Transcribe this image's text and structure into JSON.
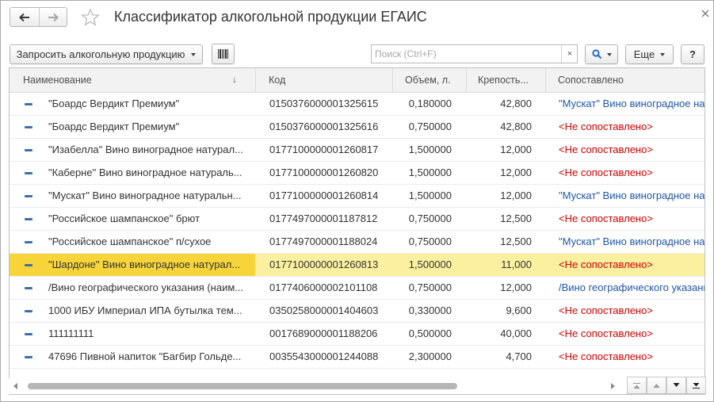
{
  "window": {
    "title": "Классификатор алкогольной продукции ЕГАИС",
    "close_glyph": "×"
  },
  "toolbar": {
    "request_button_label": "Запросить алкогольную продукцию",
    "search_placeholder": "Поиск (Ctrl+F)",
    "search_value": "",
    "search_clear_glyph": "×",
    "more_label": "Еще",
    "help_label": "?"
  },
  "table": {
    "columns": [
      "Наименование",
      "Код",
      "Объем, л.",
      "Крепость...",
      "Сопоставлено"
    ],
    "sort_indicator": "↓",
    "rows": [
      {
        "name": "\"Боардс Вердикт Премиум\"",
        "code": "0150376000001325615",
        "volume": "0,180000",
        "strength": "42,800",
        "match": "\"Мускат\" Вино виноградное на",
        "matched": true
      },
      {
        "name": "\"Боардс Вердикт Премиум\"",
        "code": "0150376000001325616",
        "volume": "0,750000",
        "strength": "42,800",
        "match": "<Не сопоставлено>",
        "matched": false
      },
      {
        "name": "\"Изабелла\" Вино виноградное натурал...",
        "code": "0177100000001260817",
        "volume": "1,500000",
        "strength": "12,000",
        "match": "<Не сопоставлено>",
        "matched": false
      },
      {
        "name": "\"Каберне\" Вино виноградное натураль...",
        "code": "0177100000001260820",
        "volume": "1,500000",
        "strength": "12,000",
        "match": "<Не сопоставлено>",
        "matched": false
      },
      {
        "name": "\"Мускат\" Вино виноградное натуральн...",
        "code": "0177100000001260814",
        "volume": "1,500000",
        "strength": "12,000",
        "match": "\"Мускат\" Вино виноградное на",
        "matched": true
      },
      {
        "name": "\"Российское шампанское\" брют",
        "code": "0177497000001187812",
        "volume": "0,750000",
        "strength": "12,500",
        "match": "<Не сопоставлено>",
        "matched": false
      },
      {
        "name": "\"Российское шампанское\" п/сухое",
        "code": "0177497000001188024",
        "volume": "0,750000",
        "strength": "12,500",
        "match": "\"Мускат\" Вино виноградное на",
        "matched": true
      },
      {
        "name": "\"Шардоне\" Вино виноградное натурал...",
        "code": "0177100000001260813",
        "volume": "1,500000",
        "strength": "11,000",
        "match": "<Не сопоставлено>",
        "matched": false,
        "selected": true
      },
      {
        "name": "/Вино географического указания (наим...",
        "code": "0177406000002101108",
        "volume": "0,750000",
        "strength": "12,000",
        "match": "/Вино географического указани",
        "matched": true
      },
      {
        "name": "1000 ИБУ Империал ИПА бутылка тем...",
        "code": "0350258000001404603",
        "volume": "0,330000",
        "strength": "9,600",
        "match": "<Не сопоставлено>",
        "matched": false
      },
      {
        "name": "111111111",
        "code": "0017689000001188206",
        "volume": "0,500000",
        "strength": "40,000",
        "match": "<Не сопоставлено>",
        "matched": false
      },
      {
        "name": "47696 Пивной напиток \"Багбир Гольде...",
        "code": "0035543000001244088",
        "volume": "2,300000",
        "strength": "4,700",
        "match": "<Не сопоставлено>",
        "matched": false
      }
    ]
  },
  "colors": {
    "selected_row": "#fbefa0",
    "selected_cell": "#f7d53a",
    "unmatched_text": "#cc0000",
    "matched_text": "#1f56a8",
    "row_icon": "#3f6ea8"
  },
  "icons": {
    "back": "arrow-left-icon",
    "forward": "arrow-right-icon",
    "favorite": "star-icon",
    "close": "close-icon",
    "barcode": "barcode-icon",
    "search": "magnifier-icon",
    "row": "dash-icon"
  }
}
